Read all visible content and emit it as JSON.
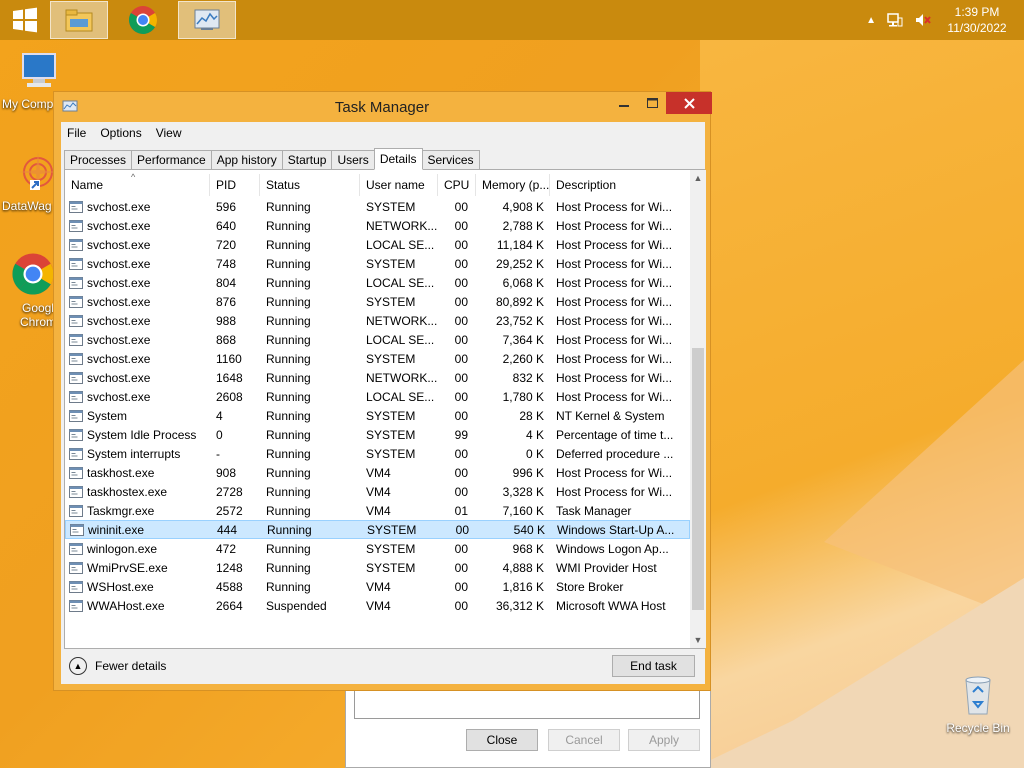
{
  "taskbar": {
    "clock_time": "1:39 PM",
    "clock_date": "11/30/2022",
    "items": [
      {
        "name": "file-explorer",
        "icon": "folder-icon"
      },
      {
        "name": "google-chrome",
        "icon": "chrome-icon"
      },
      {
        "name": "task-manager",
        "icon": "task-manager-icon"
      }
    ]
  },
  "desktop": {
    "icons": [
      {
        "label": "My Comp",
        "icon": "computer-icon"
      },
      {
        "label": "DataWag",
        "icon": "datawag-icon"
      },
      {
        "label": "Googl Chrom",
        "icon": "chrome-icon"
      },
      {
        "label": "Recycle Bin",
        "icon": "recycle-bin-icon"
      }
    ]
  },
  "background_dialog": {
    "close_label": "Close",
    "cancel_label": "Cancel",
    "apply_label": "Apply"
  },
  "window": {
    "title": "Task Manager",
    "menu": [
      "File",
      "Options",
      "View"
    ],
    "tabs": [
      "Processes",
      "Performance",
      "App history",
      "Startup",
      "Users",
      "Details",
      "Services"
    ],
    "selected_tab": "Details",
    "columns": [
      "Name",
      "PID",
      "Status",
      "User name",
      "CPU",
      "Memory (p...",
      "Description"
    ],
    "rows": [
      {
        "name": "svchost.exe",
        "pid": "596",
        "status": "Running",
        "user": "SYSTEM",
        "cpu": "00",
        "mem": "4,908 K",
        "desc": "Host Process for Wi..."
      },
      {
        "name": "svchost.exe",
        "pid": "640",
        "status": "Running",
        "user": "NETWORK...",
        "cpu": "00",
        "mem": "2,788 K",
        "desc": "Host Process for Wi..."
      },
      {
        "name": "svchost.exe",
        "pid": "720",
        "status": "Running",
        "user": "LOCAL SE...",
        "cpu": "00",
        "mem": "11,184 K",
        "desc": "Host Process for Wi..."
      },
      {
        "name": "svchost.exe",
        "pid": "748",
        "status": "Running",
        "user": "SYSTEM",
        "cpu": "00",
        "mem": "29,252 K",
        "desc": "Host Process for Wi..."
      },
      {
        "name": "svchost.exe",
        "pid": "804",
        "status": "Running",
        "user": "LOCAL SE...",
        "cpu": "00",
        "mem": "6,068 K",
        "desc": "Host Process for Wi..."
      },
      {
        "name": "svchost.exe",
        "pid": "876",
        "status": "Running",
        "user": "SYSTEM",
        "cpu": "00",
        "mem": "80,892 K",
        "desc": "Host Process for Wi..."
      },
      {
        "name": "svchost.exe",
        "pid": "988",
        "status": "Running",
        "user": "NETWORK...",
        "cpu": "00",
        "mem": "23,752 K",
        "desc": "Host Process for Wi..."
      },
      {
        "name": "svchost.exe",
        "pid": "868",
        "status": "Running",
        "user": "LOCAL SE...",
        "cpu": "00",
        "mem": "7,364 K",
        "desc": "Host Process for Wi..."
      },
      {
        "name": "svchost.exe",
        "pid": "1160",
        "status": "Running",
        "user": "SYSTEM",
        "cpu": "00",
        "mem": "2,260 K",
        "desc": "Host Process for Wi..."
      },
      {
        "name": "svchost.exe",
        "pid": "1648",
        "status": "Running",
        "user": "NETWORK...",
        "cpu": "00",
        "mem": "832 K",
        "desc": "Host Process for Wi..."
      },
      {
        "name": "svchost.exe",
        "pid": "2608",
        "status": "Running",
        "user": "LOCAL SE...",
        "cpu": "00",
        "mem": "1,780 K",
        "desc": "Host Process for Wi..."
      },
      {
        "name": "System",
        "pid": "4",
        "status": "Running",
        "user": "SYSTEM",
        "cpu": "00",
        "mem": "28 K",
        "desc": "NT Kernel & System"
      },
      {
        "name": "System Idle Process",
        "pid": "0",
        "status": "Running",
        "user": "SYSTEM",
        "cpu": "99",
        "mem": "4 K",
        "desc": "Percentage of time t..."
      },
      {
        "name": "System interrupts",
        "pid": "-",
        "status": "Running",
        "user": "SYSTEM",
        "cpu": "00",
        "mem": "0 K",
        "desc": "Deferred procedure ..."
      },
      {
        "name": "taskhost.exe",
        "pid": "908",
        "status": "Running",
        "user": "VM4",
        "cpu": "00",
        "mem": "996 K",
        "desc": "Host Process for Wi..."
      },
      {
        "name": "taskhostex.exe",
        "pid": "2728",
        "status": "Running",
        "user": "VM4",
        "cpu": "00",
        "mem": "3,328 K",
        "desc": "Host Process for Wi..."
      },
      {
        "name": "Taskmgr.exe",
        "pid": "2572",
        "status": "Running",
        "user": "VM4",
        "cpu": "01",
        "mem": "7,160 K",
        "desc": "Task Manager"
      },
      {
        "name": "wininit.exe",
        "pid": "444",
        "status": "Running",
        "user": "SYSTEM",
        "cpu": "00",
        "mem": "540 K",
        "desc": "Windows Start-Up A..."
      },
      {
        "name": "winlogon.exe",
        "pid": "472",
        "status": "Running",
        "user": "SYSTEM",
        "cpu": "00",
        "mem": "968 K",
        "desc": "Windows Logon Ap..."
      },
      {
        "name": "WmiPrvSE.exe",
        "pid": "1248",
        "status": "Running",
        "user": "SYSTEM",
        "cpu": "00",
        "mem": "4,888 K",
        "desc": "WMI Provider Host"
      },
      {
        "name": "WSHost.exe",
        "pid": "4588",
        "status": "Running",
        "user": "VM4",
        "cpu": "00",
        "mem": "1,816 K",
        "desc": "Store Broker"
      },
      {
        "name": "WWAHost.exe",
        "pid": "2664",
        "status": "Suspended",
        "user": "VM4",
        "cpu": "00",
        "mem": "36,312 K",
        "desc": "Microsoft WWA Host"
      }
    ],
    "selected_row_index": 17,
    "fewer_details_label": "Fewer details",
    "end_task_label": "End task"
  }
}
